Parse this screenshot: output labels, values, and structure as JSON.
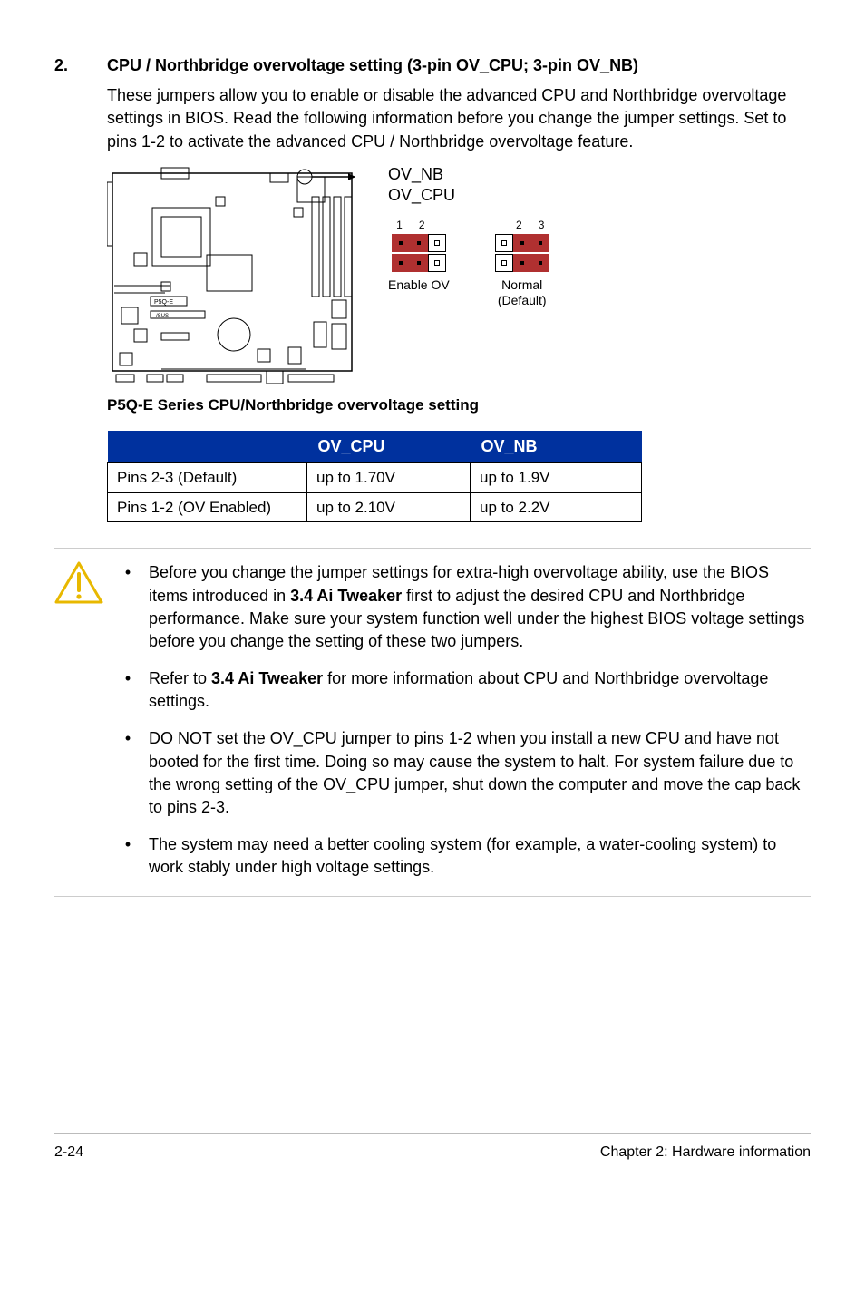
{
  "section": {
    "number": "2.",
    "title": "CPU / Northbridge overvoltage setting (3-pin OV_CPU; 3-pin OV_NB)",
    "body": "These jumpers allow you to enable or disable the advanced CPU and Northbridge overvoltage settings in BIOS. Read the following information before you change the jumper settings. Set to pins 1-2 to activate the advanced CPU / Northbridge overvoltage feature."
  },
  "diagram": {
    "label_nb": "OV_NB",
    "label_cpu": "OV_CPU",
    "enable": {
      "nums": [
        "1",
        "2"
      ],
      "caption": "Enable OV"
    },
    "normal": {
      "nums": [
        "2",
        "3"
      ],
      "caption1": "Normal",
      "caption2": "(Default)"
    },
    "board_label": "P5Q-E",
    "title": "P5Q-E Series CPU/Northbridge overvoltage setting"
  },
  "table": {
    "headers": [
      "",
      "OV_CPU",
      "OV_NB"
    ],
    "rows": [
      {
        "label": "Pins 2-3 (Default)",
        "cpu": "up to 1.70V",
        "nb": "up to 1.9V"
      },
      {
        "label": "Pins 1-2 (OV Enabled)",
        "cpu": "up to 2.10V",
        "nb": "up to 2.2V"
      }
    ]
  },
  "callout": {
    "items": [
      {
        "pre": "Before you change the jumper settings for extra-high overvoltage ability, use the BIOS items introduced in ",
        "bold": "3.4 Ai Tweaker",
        "post": " first to adjust the desired CPU and Northbridge performance. Make sure your system function well under the highest BIOS voltage settings before you change the setting of these two jumpers."
      },
      {
        "pre": "Refer to ",
        "bold": "3.4 Ai Tweaker",
        "post": " for more information about CPU and Northbridge overvoltage settings."
      },
      {
        "pre": "DO NOT set the OV_CPU jumper to pins 1-2 when you install a new CPU and have not booted for the first time. Doing so may cause the system to halt. For system failure due to the wrong setting of the OV_CPU jumper, shut down the computer and move the cap back to pins 2-3.",
        "bold": "",
        "post": ""
      },
      {
        "pre": "The system may need a better cooling system (for example, a water-cooling system) to work stably under high voltage settings.",
        "bold": "",
        "post": ""
      }
    ]
  },
  "footer": {
    "left": "2-24",
    "right": "Chapter 2: Hardware information"
  }
}
